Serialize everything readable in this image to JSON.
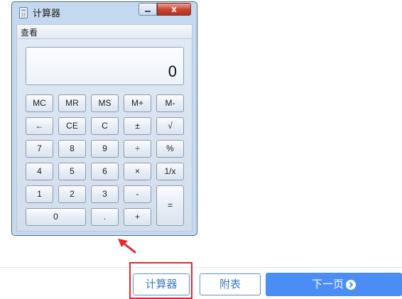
{
  "calculator": {
    "title": "计算器",
    "close_glyph": "x",
    "menu": [
      "查看"
    ],
    "display_value": "0",
    "keys": {
      "mc": "MC",
      "mr": "MR",
      "ms": "MS",
      "m_plus": "M+",
      "m_minus": "M-",
      "backspace": "←",
      "ce": "CE",
      "c": "C",
      "plus_minus": "±",
      "sqrt": "√",
      "k7": "7",
      "k8": "8",
      "k9": "9",
      "divide": "÷",
      "percent": "%",
      "k4": "4",
      "k5": "5",
      "k6": "6",
      "multiply": "×",
      "reciprocal": "1/x",
      "k1": "1",
      "k2": "2",
      "k3": "3",
      "minus": "-",
      "k0": "0",
      "decimal": ".",
      "plus": "+",
      "equals": "="
    },
    "icon": "calculator-icon"
  },
  "footer": {
    "calculator_button": "计算器",
    "appendix_button": "附表",
    "next_button": "下一页",
    "next_icon": "chevron-right-circle-icon"
  },
  "annotation": {
    "color": "#e0282e"
  },
  "colors": {
    "primary": "#4a8ef5",
    "outline": "#5b8ed6",
    "highlight": "#e0282e"
  }
}
